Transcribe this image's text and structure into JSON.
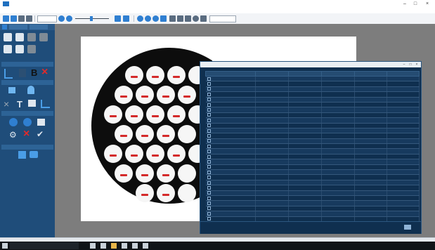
{
  "window": {
    "title": ""
  },
  "menu": {
    "items": []
  },
  "toolbar": {
    "combo_value": "",
    "zoom_value": ""
  },
  "sidebar": {
    "sections": []
  },
  "results": {
    "title": "",
    "columns": [
      "",
      "",
      "",
      "",
      "",
      ""
    ],
    "rows": [
      {
        "cells": [
          "",
          "",
          "",
          "",
          "",
          ""
        ]
      },
      {
        "cells": [
          "",
          "",
          "",
          "",
          "",
          ""
        ]
      },
      {
        "cells": [
          "",
          "",
          "",
          "",
          "",
          ""
        ]
      },
      {
        "cells": [
          "",
          "",
          "",
          "",
          "",
          ""
        ]
      },
      {
        "cells": [
          "",
          "",
          "",
          "",
          "",
          ""
        ]
      },
      {
        "cells": [
          "",
          "",
          "",
          "",
          "",
          ""
        ]
      },
      {
        "cells": [
          "",
          "",
          "",
          "",
          "",
          ""
        ]
      },
      {
        "cells": [
          "",
          "",
          "",
          "",
          "",
          ""
        ]
      },
      {
        "cells": [
          "",
          "",
          "",
          "",
          "",
          ""
        ]
      },
      {
        "cells": [
          "",
          "",
          "",
          "",
          "",
          ""
        ]
      },
      {
        "cells": [
          "",
          "",
          "",
          "",
          "",
          ""
        ]
      },
      {
        "cells": [
          "",
          "",
          "",
          "",
          "",
          ""
        ]
      },
      {
        "cells": [
          "",
          "",
          "",
          "",
          "",
          ""
        ]
      },
      {
        "cells": [
          "",
          "",
          "",
          "",
          "",
          ""
        ]
      },
      {
        "cells": [
          "",
          "",
          "",
          "",
          "",
          ""
        ]
      },
      {
        "cells": [
          "",
          "",
          "",
          "",
          "",
          ""
        ]
      },
      {
        "cells": [
          "",
          "",
          "",
          "",
          "",
          ""
        ]
      },
      {
        "cells": [
          "",
          "",
          "",
          "",
          "",
          ""
        ]
      },
      {
        "cells": [
          "",
          "",
          "",
          "",
          "",
          ""
        ]
      },
      {
        "cells": [
          "",
          "",
          "",
          "",
          "",
          ""
        ]
      },
      {
        "cells": [
          "",
          "",
          "",
          "",
          "",
          ""
        ]
      },
      {
        "cells": [
          "",
          "",
          "",
          "",
          "",
          ""
        ]
      },
      {
        "cells": [
          "",
          "",
          "",
          "",
          "",
          ""
        ]
      },
      {
        "cells": [
          "",
          "",
          "",
          "",
          "",
          ""
        ]
      },
      {
        "cells": [
          "",
          "",
          "",
          "",
          "",
          ""
        ]
      },
      {
        "cells": [
          "",
          "",
          "",
          "",
          "",
          ""
        ]
      },
      {
        "cells": [
          "",
          "",
          "",
          "",
          "",
          ""
        ]
      },
      {
        "cells": [
          "",
          "",
          "",
          "",
          "",
          ""
        ]
      }
    ],
    "footer": {
      "left": "",
      "middle": "",
      "right": ""
    }
  },
  "statusbar": {
    "left": "",
    "right": ""
  },
  "taskbar": {
    "search_placeholder": "",
    "time": "",
    "date": ""
  },
  "colors": {
    "sidebar": "#1f4d7a",
    "results_bg": "#0f2f4f",
    "accent": "#1f6fbf",
    "close_red": "#d42a2a"
  },
  "icons": {
    "toolbar": [
      "new-icon",
      "open-icon",
      "save-icon",
      "print-icon",
      "zoom-in-icon",
      "zoom-out-icon",
      "fit-icon",
      "select-icon",
      "line-icon",
      "circle-icon"
    ],
    "sidebar": [
      "measure-icon",
      "ruler-icon",
      "bold-icon",
      "delete-icon",
      "move-icon",
      "person-icon",
      "table-icon",
      "chart-icon",
      "grid-icon",
      "globe-icon",
      "refresh-icon",
      "settings-icon",
      "close-icon",
      "check-icon",
      "scan-icon",
      "camera-icon"
    ]
  }
}
